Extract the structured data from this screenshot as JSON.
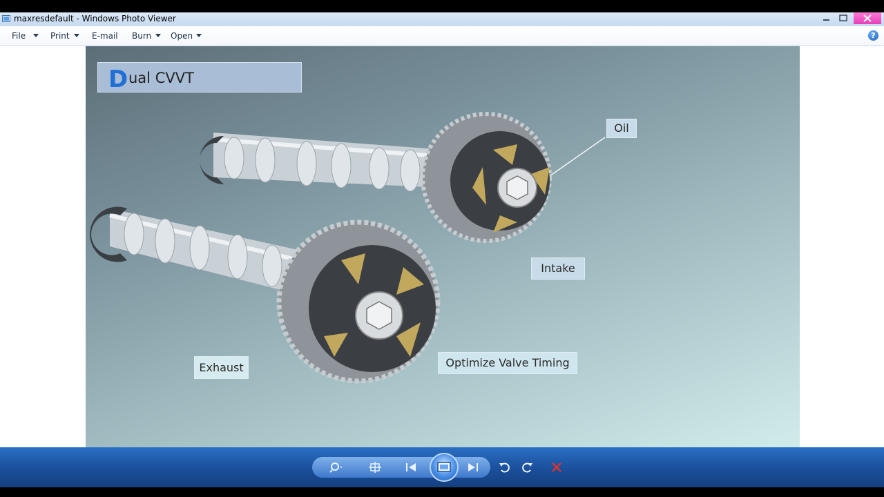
{
  "window": {
    "title": "maxresdefault - Windows Photo Viewer",
    "controls": [
      "minimize-icon",
      "maximize-icon",
      "close-icon"
    ]
  },
  "menu": {
    "items": [
      {
        "label": "File",
        "dropdown": true
      },
      {
        "label": "Print",
        "dropdown": true
      },
      {
        "label": "E-mail",
        "dropdown": false
      },
      {
        "label": "Burn",
        "dropdown": true
      },
      {
        "label": "Open",
        "dropdown": true
      }
    ],
    "help_label": "?"
  },
  "image": {
    "title_initial": "D",
    "title_rest": "ual CVVT",
    "labels": {
      "oil": "Oil",
      "intake": "Intake",
      "exhaust": "Exhaust",
      "optimize": "Optimize Valve Timing"
    }
  },
  "toolbar": {
    "buttons": [
      "zoom-icon",
      "actual-size-icon",
      "previous-icon",
      "slideshow-icon",
      "next-icon",
      "rotate-counterclockwise-icon",
      "rotate-clockwise-icon",
      "delete-icon"
    ]
  },
  "colors": {
    "accent_blue": "#1f6fd6",
    "toolbar_blue": "#1a4f9a",
    "delete_red": "#e0322a"
  }
}
